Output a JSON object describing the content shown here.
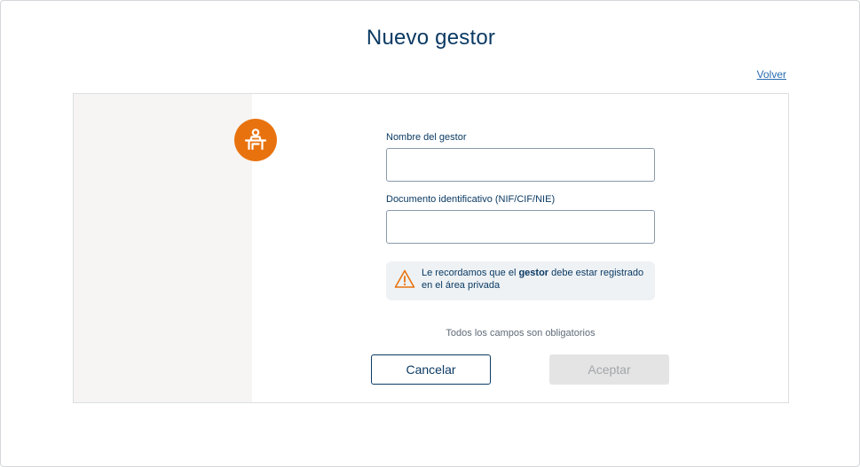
{
  "header": {
    "title": "Nuevo gestor",
    "back_link": "Volver"
  },
  "form": {
    "name_label": "Nombre del gestor",
    "name_value": "",
    "document_label": "Documento identificativo (NIF/CIF/NIE)",
    "document_value": ""
  },
  "notice": {
    "text_before": "Le recordamos que el ",
    "text_bold": "gestor",
    "text_after": " debe estar registrado en el área privada",
    "icon": "warning-icon"
  },
  "required_note": "Todos los campos son obligatorios",
  "buttons": {
    "cancel_label": "Cancelar",
    "accept_label": "Aceptar"
  },
  "avatar": {
    "icon": "desk-person-icon"
  },
  "colors": {
    "brand_navy": "#0b3a63",
    "accent_orange": "#e8730e",
    "link_blue": "#2a6cb0",
    "disabled_bg": "#e4e4e4",
    "side_panel_bg": "#f6f5f3",
    "notice_bg": "#eef2f5"
  }
}
